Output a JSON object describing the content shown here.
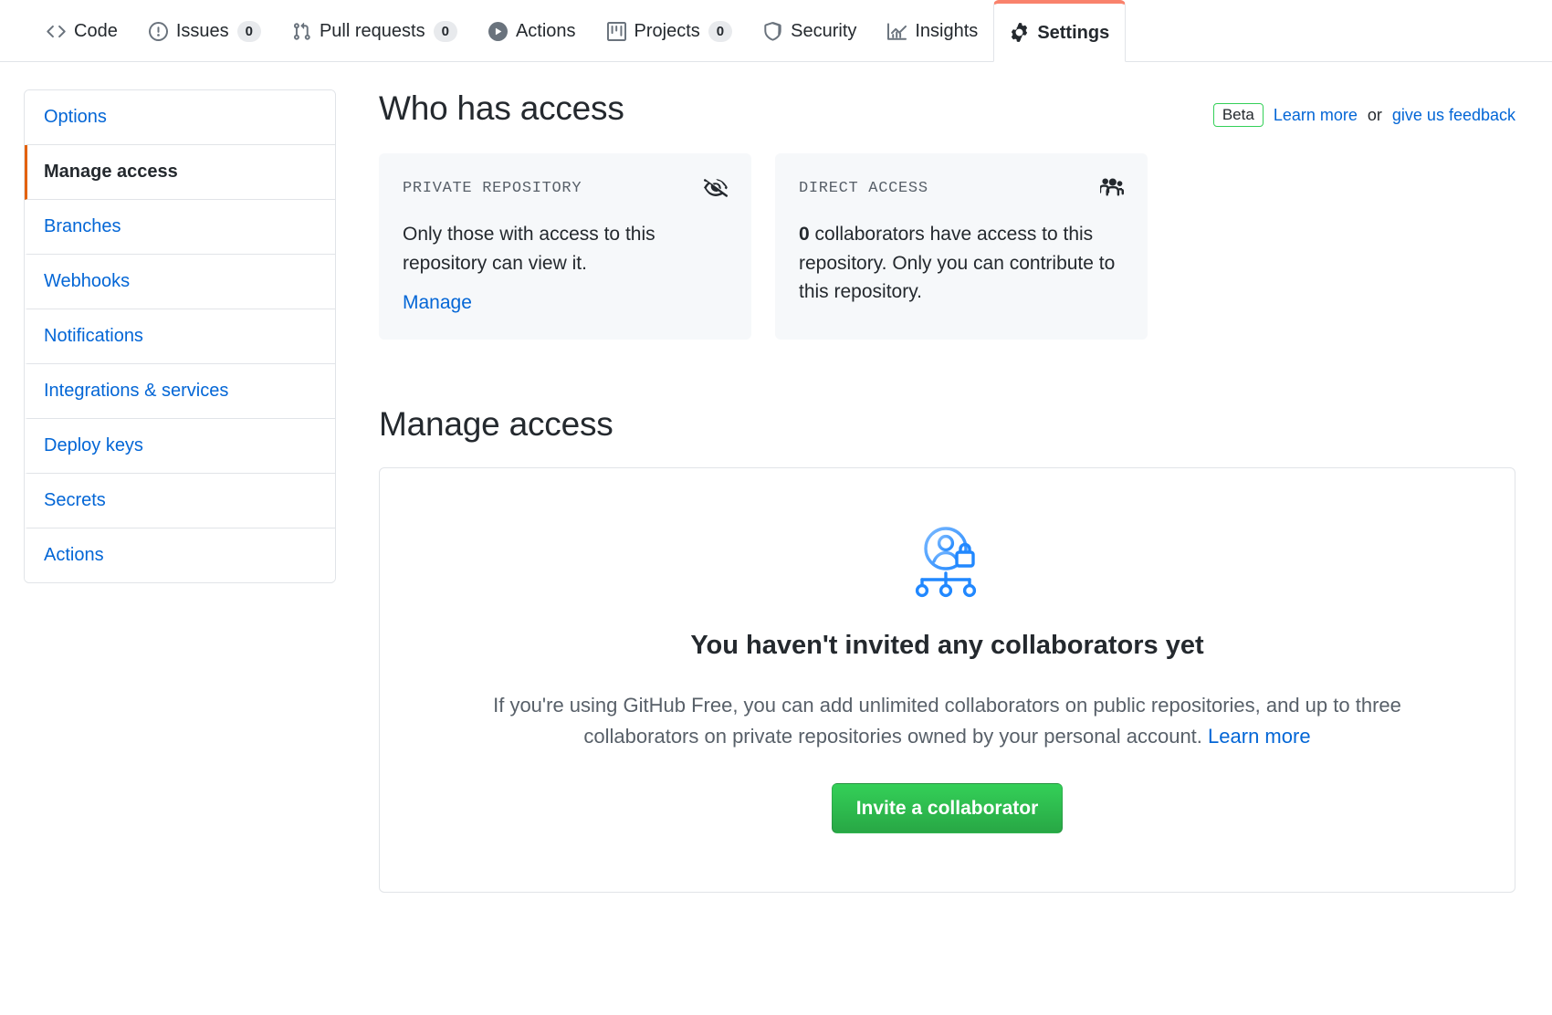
{
  "repo_nav": {
    "items": [
      {
        "label": "Code",
        "icon": "code-icon",
        "count": null,
        "selected": false
      },
      {
        "label": "Issues",
        "icon": "issue-opened-icon",
        "count": "0",
        "selected": false
      },
      {
        "label": "Pull requests",
        "icon": "git-pull-request-icon",
        "count": "0",
        "selected": false
      },
      {
        "label": "Actions",
        "icon": "play-icon",
        "count": null,
        "selected": false
      },
      {
        "label": "Projects",
        "icon": "project-board-icon",
        "count": "0",
        "selected": false
      },
      {
        "label": "Security",
        "icon": "shield-icon",
        "count": null,
        "selected": false
      },
      {
        "label": "Insights",
        "icon": "graph-bar-icon",
        "count": null,
        "selected": false
      },
      {
        "label": "Settings",
        "icon": "gear-icon",
        "count": null,
        "selected": true
      }
    ]
  },
  "sidebar": {
    "items": [
      {
        "label": "Options",
        "selected": false
      },
      {
        "label": "Manage access",
        "selected": true
      },
      {
        "label": "Branches",
        "selected": false
      },
      {
        "label": "Webhooks",
        "selected": false
      },
      {
        "label": "Notifications",
        "selected": false
      },
      {
        "label": "Integrations & services",
        "selected": false
      },
      {
        "label": "Deploy keys",
        "selected": false
      },
      {
        "label": "Secrets",
        "selected": false
      },
      {
        "label": "Actions",
        "selected": false
      }
    ]
  },
  "who_has_access": {
    "title": "Who has access",
    "beta_badge": "Beta",
    "learn_more": "Learn more",
    "or_text": "or",
    "feedback_link": "give us feedback",
    "cards": [
      {
        "label": "PRIVATE REPOSITORY",
        "icon": "eye-closed-icon",
        "body": "Only those with access to this repository can view it.",
        "link": "Manage"
      },
      {
        "label": "DIRECT ACCESS",
        "icon": "people-icon",
        "body_strong": "0",
        "body": " collaborators have access to this repository. Only you can contribute to this repository.",
        "link": null
      }
    ]
  },
  "manage_access": {
    "title": "Manage access",
    "blank_icon": "collaborators-lock-illustration",
    "blank_title": "You haven't invited any collaborators yet",
    "blank_text": "If you're using GitHub Free, you can add unlimited collaborators on public repositories, and up to three collaborators on private repositories owned by your personal account.",
    "blank_text_link": "Learn more",
    "invite_button": "Invite a collaborator"
  },
  "colors": {
    "link": "#0366d6",
    "accent_orange": "#f9826c",
    "selected_border": "#e36209",
    "green_button": "#2ea44f",
    "beta_border": "#34d058",
    "muted_text": "#586069",
    "card_bg": "#f6f8fa",
    "border": "#e1e4e8"
  }
}
